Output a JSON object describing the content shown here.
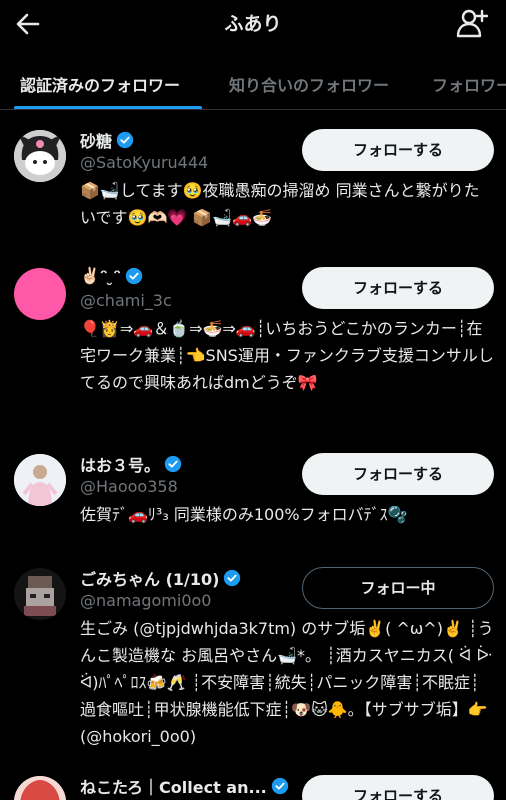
{
  "header": {
    "title": "ふあり"
  },
  "tabs": [
    {
      "label": "認証済みのフォロワー"
    },
    {
      "label": "知り合いのフォロワー"
    },
    {
      "label": "フォロワー"
    }
  ],
  "colors": {
    "accent": "#1d9bf0",
    "background": "#000000",
    "secondary_text": "#71767b"
  },
  "users": [
    {
      "name": "砂糖",
      "handle": "@SatoKyuru444",
      "bio": "📦🛁してます🥹夜職愚痴の掃溜め 同業さんと繋がりたいです🥹🫶🏻💗 📦🛁🚗🍜",
      "button": "フォローする"
    },
    {
      "name": "✌🏻ᵔ ̮ᵔ",
      "handle": "@chami_3c",
      "bio": "🎈👸⇒🚗＆🍵⇒🍜⇒🚗┊いちおうどこかのランカー┊在宅ワーク兼業┊👈SNS運用・ファンクラブ支援コンサルしてるので興味あればdmどうぞ🎀",
      "button": "フォローする"
    },
    {
      "name": "はお３号。",
      "handle": "@Haooo358",
      "bio": "佐賀ﾃﾞ🚗ﾘ³₃ 同業様のみ100%フォロバﾃﾞｽ🫧",
      "button": "フォローする"
    },
    {
      "name": "ごみちゃん (1/10)",
      "handle": "@namagomi0o0",
      "bio": "生ごみ (@tjpjdwhjda3k7tm) のサブ垢✌️( ^ω^)✌️ ┊うんこ製造機な お風呂やさん🛁*。 ┊酒カスヤニカス( ᐛ ᐕ ᐛ)ﾊﾟﾍﾟﾛｽ🍻🥂 ┊不安障害┊統失┊パニック障害┊不眠症┊過食嘔吐┊甲状腺機能低下症┊🐶🐱🐥｡【サブサブ垢】👉(@hokori_0o0)",
      "button": "フォロー中"
    },
    {
      "name": "ねこたろ｜Collect an...",
      "handle": "",
      "bio": "",
      "button": "フォローする"
    }
  ]
}
